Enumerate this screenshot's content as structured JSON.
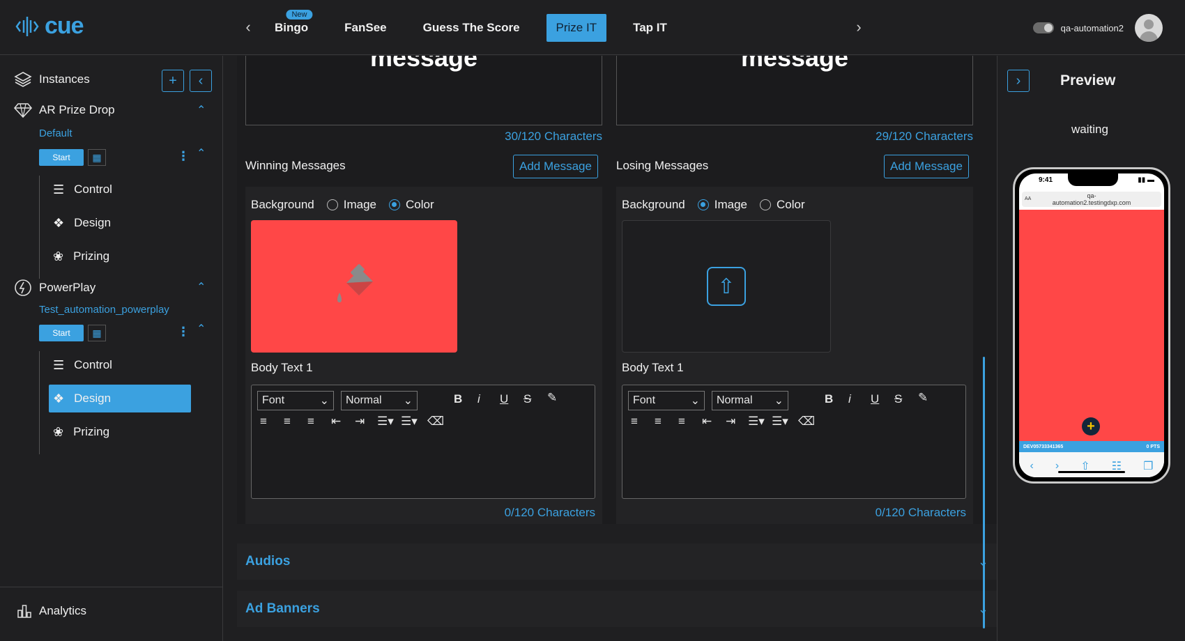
{
  "app": {
    "logo": "cue"
  },
  "topnav": {
    "tabs": [
      {
        "label": "Bingo",
        "badge": "New"
      },
      {
        "label": "FanSee"
      },
      {
        "label": "Guess The Score"
      },
      {
        "label": "Prize IT",
        "active": true
      },
      {
        "label": "Tap IT"
      }
    ],
    "username": "qa-automation2"
  },
  "sidebar": {
    "instances_label": "Instances",
    "groups": [
      {
        "title": "AR Prize Drop",
        "instance": "Default",
        "start_label": "Start",
        "items": [
          "Control",
          "Design",
          "Prizing"
        ]
      },
      {
        "title": "PowerPlay",
        "instance": "Test_automation_powerplay",
        "start_label": "Start",
        "items": [
          "Control",
          "Design",
          "Prizing"
        ],
        "active_item": "Design"
      }
    ],
    "analytics_label": "Analytics"
  },
  "main": {
    "left_message_text": "message",
    "right_message_text": "message",
    "left_chars": "30/120 Characters",
    "right_chars": "29/120 Characters",
    "winning": {
      "label": "Winning Messages",
      "add_label": "Add Message",
      "background_label": "Background",
      "option_image": "Image",
      "option_color": "Color",
      "selected": "Color",
      "swatch_color": "#ff4747",
      "body_label": "Body Text 1",
      "font_select": "Font",
      "size_select": "Normal",
      "chars": "0/120 Characters"
    },
    "losing": {
      "label": "Losing Messages",
      "add_label": "Add Message",
      "background_label": "Background",
      "option_image": "Image",
      "option_color": "Color",
      "selected": "Image",
      "body_label": "Body Text 1",
      "font_select": "Font",
      "size_select": "Normal",
      "chars": "0/120 Characters"
    },
    "accordions": [
      "Audios",
      "Ad Banners"
    ]
  },
  "preview": {
    "title": "Preview",
    "status": "waiting",
    "phone": {
      "time": "9:41",
      "url_line1": "qa-",
      "url_line2": "automation2.testingdxp.com",
      "aa": "AA",
      "strip_left": "DEV05733341365",
      "strip_right": "0 PTS",
      "bg_color": "#ff4747"
    }
  },
  "colors": {
    "accent": "#3ba1e0",
    "background": "#1f1f21",
    "swatch": "#ff4747"
  }
}
